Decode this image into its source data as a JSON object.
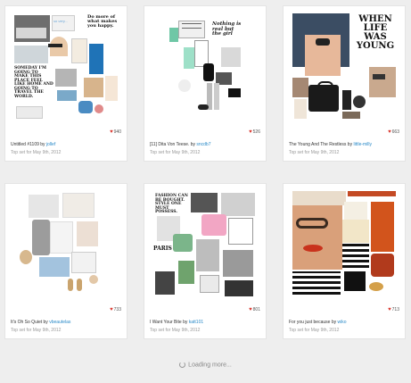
{
  "cards": [
    {
      "likes": "940",
      "title": "Untitled #1109",
      "by": "by",
      "author": "jollef",
      "subtitle": "Top set for May 9th, 2012",
      "art": {
        "line1": "Do more of what makes you happy.",
        "line2": "SOMEDAY I'M GOING TO MAKE THIS PLACE FEEL LIKE HOME AND GOING TO TRAVEL THE WORLD."
      }
    },
    {
      "likes": "526",
      "title": "[11] Dita Von Teese.",
      "by": "by",
      "author": "sncdb7",
      "subtitle": "Top set for May 9th, 2012",
      "art": {
        "line1": "Nothing is real but the girl"
      }
    },
    {
      "likes": "663",
      "title": "The Young And The Restless",
      "by": "by",
      "author": "little-milly",
      "subtitle": "Top set for May 9th, 2012",
      "art": {
        "line1": "WHEN LIFE WAS YOUNG"
      }
    },
    {
      "likes": "733",
      "title": "It's Oh So Quiet",
      "by": "by",
      "author": "vbeautelas",
      "subtitle": "Top set for May 9th, 2012",
      "art": {}
    },
    {
      "likes": "801",
      "title": "I Want Your Bite",
      "by": "by",
      "author": "katt101",
      "subtitle": "Top set for May 9th, 2012",
      "art": {
        "line1": "FASHION CAN BE BOUGHT. STYLE ONE MUST POSSESS.",
        "line2": "PARIS"
      }
    },
    {
      "likes": "713",
      "title": "For you just because",
      "by": "by",
      "author": "wiko",
      "subtitle": "Top set for May 9th, 2012",
      "art": {}
    }
  ],
  "loading_text": "Loading more...",
  "colors": {
    "link": "#2a8ac8",
    "heart": "#d9342b",
    "background": "#eeeeee"
  }
}
